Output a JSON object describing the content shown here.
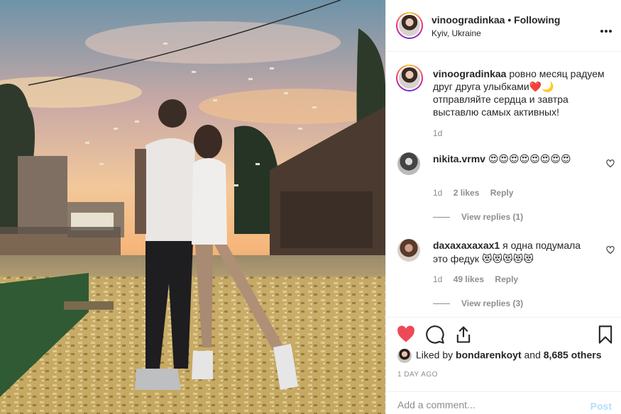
{
  "post": {
    "image_alt": "Couple standing in confetti at sunset"
  },
  "header": {
    "username": "vinoogradinkaa",
    "separator": " • ",
    "follow_status": "Following",
    "location": "Kyiv, Ukraine",
    "more_icon": "more-horizontal-icon"
  },
  "caption": {
    "username": "vinoogradinkaa",
    "text": "ровно месяц радуем друг друга улыбками❤️🌙 отправляйте сердца и завтра выставлю самых активных!",
    "age": "1d"
  },
  "comments": [
    {
      "username": "nikita.vrmv",
      "text": "😍😍😍😍😍😍😍😍",
      "age": "1d",
      "likes": "2 likes",
      "reply": "Reply",
      "view_replies": "View replies (1)"
    },
    {
      "username": "daxaxaxaxax1",
      "text": "я одна подумала это федук 😻😻😻😻😻",
      "age": "1d",
      "likes": "49 likes",
      "reply": "Reply",
      "view_replies": "View replies (3)"
    }
  ],
  "actions": {
    "like_icon": "heart-filled-icon",
    "comment_icon": "comment-bubble-icon",
    "share_icon": "share-icon",
    "save_icon": "bookmark-icon",
    "like_color": "#ed4956"
  },
  "likes": {
    "prefix": "Liked by ",
    "user": "bondarenkoyt",
    "middle": " and ",
    "others": "8,685 others"
  },
  "timestamp": "1 DAY AGO",
  "comment_input": {
    "placeholder": "Add a comment...",
    "post_label": "Post"
  }
}
